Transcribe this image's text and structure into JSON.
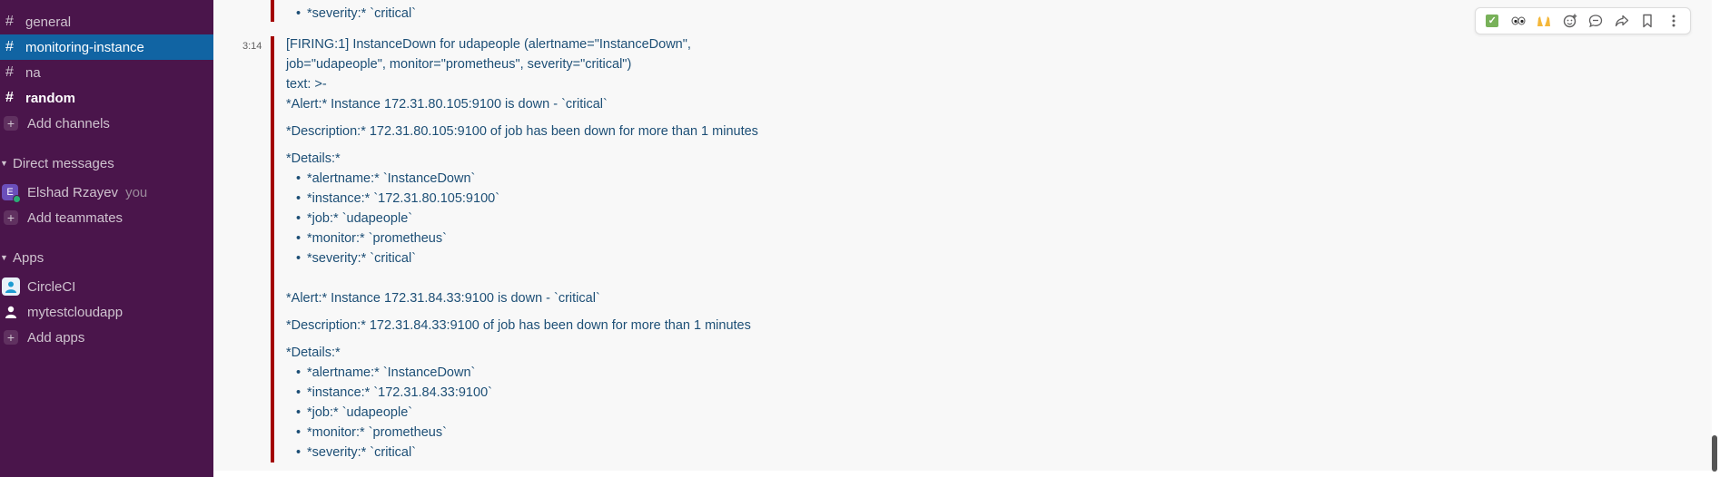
{
  "sidebar": {
    "channels": [
      {
        "label": "general",
        "state": "normal"
      },
      {
        "label": "monitoring-instance",
        "state": "active"
      },
      {
        "label": "na",
        "state": "normal"
      },
      {
        "label": "random",
        "state": "bold"
      }
    ],
    "add_channels": "Add channels",
    "dm_header": "Direct messages",
    "dm_user": {
      "avatar_initial": "E",
      "name": "Elshad Rzayev",
      "suffix": "you"
    },
    "add_teammates": "Add teammates",
    "apps_header": "Apps",
    "apps": [
      "CircleCI",
      "mytestcloudapp"
    ],
    "add_apps": "Add apps"
  },
  "message": {
    "time": "3:14",
    "prev_tail": "*severity:* `critical`",
    "title_line1": "[FIRING:1] InstanceDown for udapeople (alertname=\"InstanceDown\",",
    "title_line2": "job=\"udapeople\", monitor=\"prometheus\", severity=\"critical\")",
    "text_line": "text: >-",
    "alerts": [
      {
        "alert": "*Alert:* Instance 172.31.80.105:9100  is down - `critical`",
        "description": "*Description:* 172.31.80.105:9100 of job  has been down for more than 1 minutes",
        "details_label": "*Details:*",
        "details": [
          "*alertname:* `InstanceDown`",
          "*instance:* `172.31.80.105:9100`",
          "*job:* `udapeople`",
          "*monitor:* `prometheus`",
          "*severity:* `critical`"
        ]
      },
      {
        "alert": "*Alert:* Instance 172.31.84.33:9100  is down - `critical`",
        "description": "*Description:* 172.31.84.33:9100 of job  has been down for more than 1 minutes",
        "details_label": "*Details:*",
        "details": [
          "*alertname:* `InstanceDown`",
          "*instance:* `172.31.84.33:9100`",
          "*job:* `udapeople`",
          "*monitor:* `prometheus`",
          "*severity:* `critical`"
        ]
      }
    ]
  },
  "colors": {
    "sidebar_bg": "#4a154b",
    "active_channel": "#1164a3",
    "attachment_bar": "#a30200",
    "message_text": "#1d4f76"
  },
  "toolbar_icons": [
    "white-check-mark-icon",
    "eyes-icon",
    "raised-hands-icon",
    "add-reaction-icon",
    "reply-in-thread-icon",
    "share-icon",
    "bookmark-icon",
    "more-actions-icon"
  ]
}
